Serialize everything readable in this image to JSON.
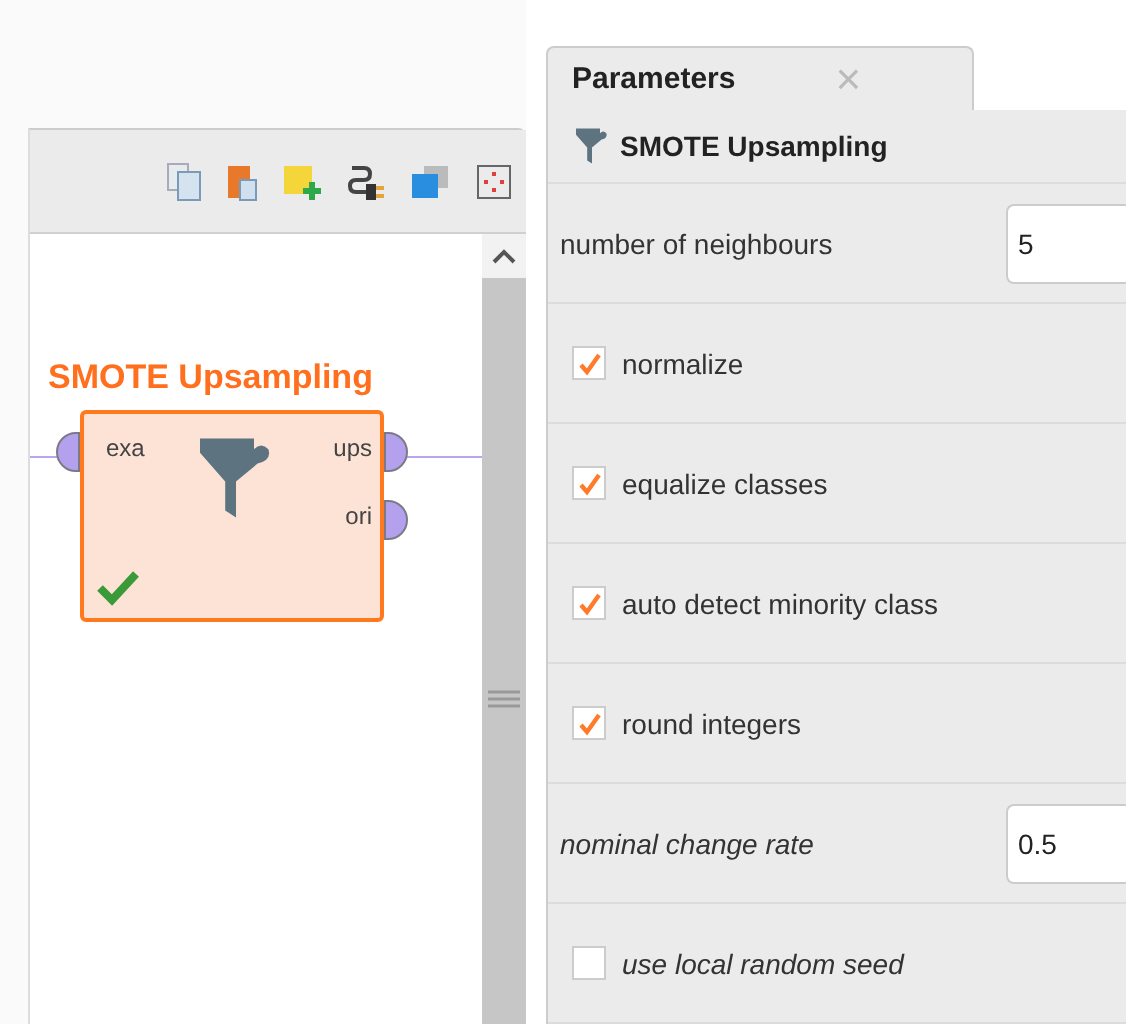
{
  "operator": {
    "title": "SMOTE Upsampling",
    "inputs": [
      "exa"
    ],
    "outputs": [
      "ups",
      "ori"
    ],
    "ready": true
  },
  "tab": {
    "label": "Parameters",
    "close": "×",
    "selected": true
  },
  "header": "SMOTE Upsampling",
  "parameters": [
    {
      "kind": "field",
      "label": "number of neighbours",
      "value": "5",
      "expert": false
    },
    {
      "kind": "checkbox",
      "label": "normalize",
      "checked": true,
      "expert": false
    },
    {
      "kind": "checkbox",
      "label": "equalize classes",
      "checked": true,
      "expert": false
    },
    {
      "kind": "checkbox",
      "label": "auto detect minority class",
      "checked": true,
      "expert": false
    },
    {
      "kind": "checkbox",
      "label": "round integers",
      "checked": true,
      "expert": false
    },
    {
      "kind": "field",
      "label": "nominal change rate",
      "value": "0.5",
      "expert": true
    },
    {
      "kind": "checkbox",
      "label": "use local random seed",
      "checked": false,
      "expert": true
    }
  ]
}
